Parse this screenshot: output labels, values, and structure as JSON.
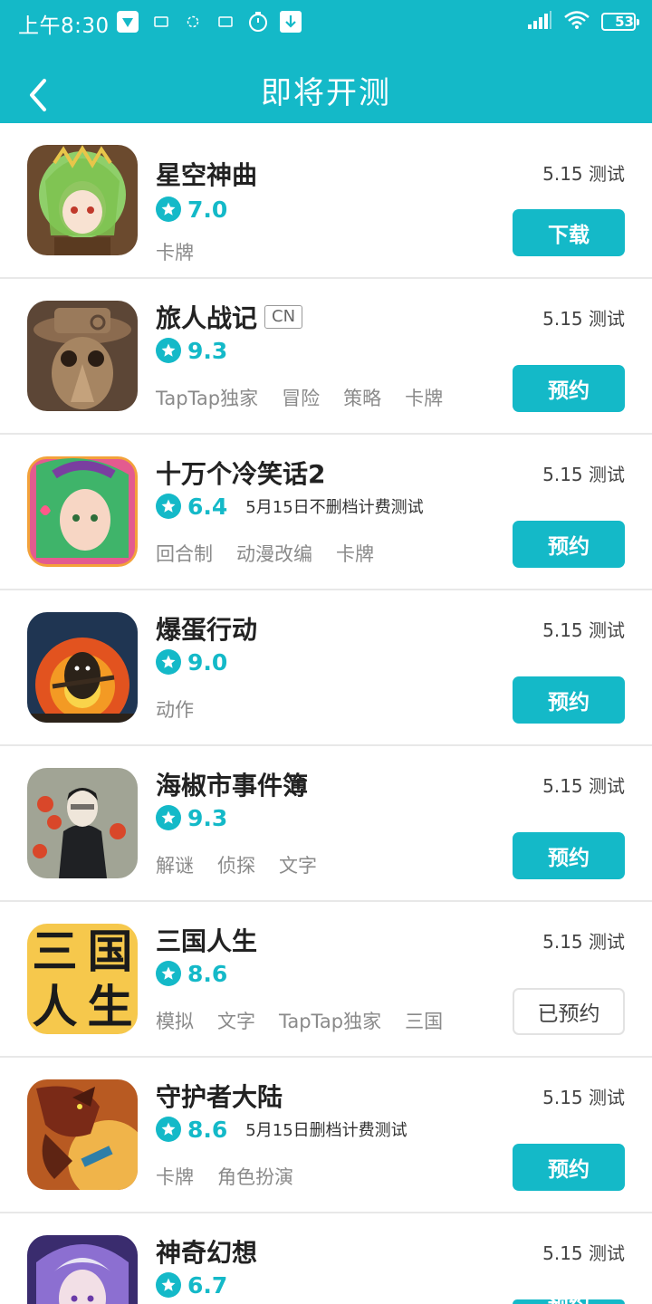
{
  "status_bar": {
    "time": "上午8:30",
    "battery": "53",
    "icons": [
      "app-notification-icon",
      "small-notification-icon",
      "small-notification-icon",
      "small-notification-icon",
      "timer-icon",
      "download-icon",
      "signal-icon",
      "wifi-icon",
      "battery-icon"
    ]
  },
  "header": {
    "title": "即将开测",
    "back_icon": "chevron-left-icon"
  },
  "games": [
    {
      "name": "星空神曲",
      "score": "7.0",
      "tags": [
        "卡牌"
      ],
      "date": "5.15 测试",
      "action": "下载",
      "reserved": false
    },
    {
      "name": "旅人战记",
      "region": "CN",
      "score": "9.3",
      "tags": [
        "TapTap独家",
        "冒险",
        "策略",
        "卡牌"
      ],
      "date": "5.15 测试",
      "action": "预约",
      "reserved": false
    },
    {
      "name": "十万个冷笑话2",
      "score": "6.4",
      "note": "5月15日不删档计费测试",
      "tags": [
        "回合制",
        "动漫改编",
        "卡牌"
      ],
      "date": "5.15 测试",
      "action": "预约",
      "reserved": false
    },
    {
      "name": "爆蛋行动",
      "score": "9.0",
      "tags": [
        "动作"
      ],
      "date": "5.15 测试",
      "action": "预约",
      "reserved": false
    },
    {
      "name": "海椒市事件簿",
      "score": "9.3",
      "tags": [
        "解谜",
        "侦探",
        "文字"
      ],
      "date": "5.15 测试",
      "action": "预约",
      "reserved": false
    },
    {
      "name": "三国人生",
      "score": "8.6",
      "tags": [
        "模拟",
        "文字",
        "TapTap独家",
        "三国"
      ],
      "date": "5.15 测试",
      "action": "已预约",
      "reserved": true,
      "icon_text": [
        "三",
        "国",
        "人",
        "生"
      ]
    },
    {
      "name": "守护者大陆",
      "score": "8.6",
      "note": "5月15日删档计费测试",
      "tags": [
        "卡牌",
        "角色扮演"
      ],
      "date": "5.15 测试",
      "action": "预约",
      "reserved": false
    },
    {
      "name": "神奇幻想",
      "score": "6.7",
      "tags": [],
      "date": "5.15 测试",
      "action": "预约",
      "reserved": false
    }
  ],
  "colors": {
    "accent": "#14b9c8",
    "tag_text": "#8a8a8a",
    "divider": "#e8e8e8"
  }
}
